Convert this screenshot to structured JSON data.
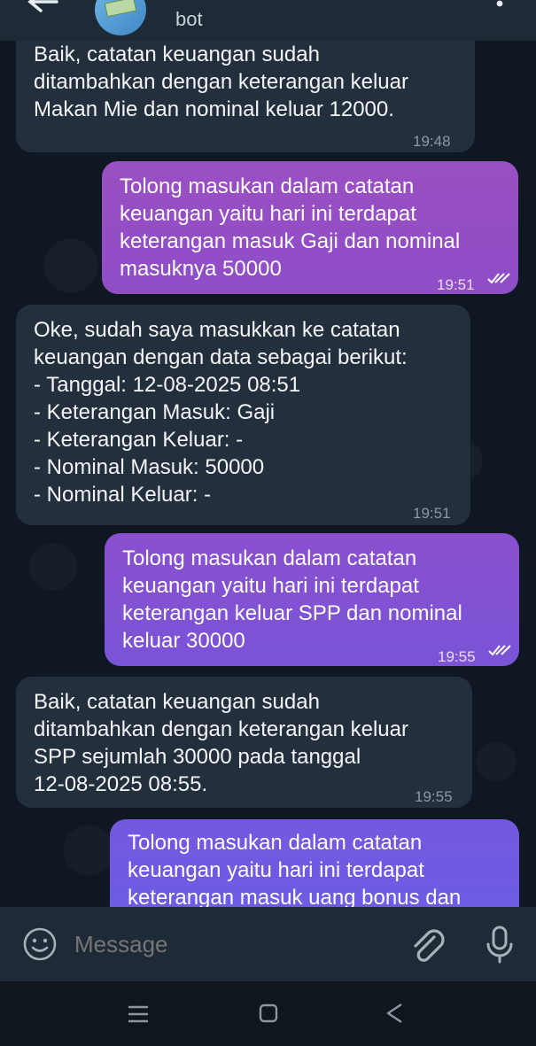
{
  "header": {
    "title": "bot"
  },
  "messages": [
    {
      "direction": "incoming",
      "text": "Baik, catatan keuangan sudah\nditambahkan dengan keterangan keluar\nMakan Mie dan nominal keluar 12000.",
      "time": "19:48"
    },
    {
      "direction": "outgoing",
      "text": "Tolong masukan dalam catatan\nkeuangan yaitu hari ini terdapat\nketerangan masuk Gaji dan nominal\nmasuknya 50000",
      "time": "19:51",
      "status": "read"
    },
    {
      "direction": "incoming",
      "text": "Oke, sudah saya masukkan ke catatan\nkeuangan dengan data sebagai berikut:\n- Tanggal: 12-08-2025 08:51\n- Keterangan Masuk: Gaji\n- Keterangan Keluar: -\n- Nominal Masuk: 50000\n- Nominal Keluar: -",
      "time": "19:51"
    },
    {
      "direction": "outgoing",
      "text": "Tolong masukan dalam catatan\nkeuangan yaitu hari ini terdapat\nketerangan keluar SPP dan nominal\nkeluar 30000",
      "time": "19:55",
      "status": "read"
    },
    {
      "direction": "incoming",
      "text": "Baik, catatan keuangan sudah\nditambahkan dengan keterangan keluar\nSPP sejumlah 30000 pada tanggal\n12-08-2025 08:55.",
      "time": "19:55"
    },
    {
      "direction": "outgoing",
      "text": "Tolong masukan dalam catatan\nkeuangan yaitu hari ini terdapat\nketerangan masuk uang bonus dan",
      "time": "",
      "status": ""
    }
  ],
  "input": {
    "placeholder": "Message"
  },
  "icons": {
    "back": "arrow-left-icon",
    "menu": "more-vertical-icon",
    "emoji": "smile-icon",
    "attach": "paperclip-icon",
    "mic": "microphone-icon"
  },
  "colors": {
    "incoming_bubble": "#232f3c",
    "outgoing_gradient_top": "#9b4fc4",
    "outgoing_gradient_bottom": "#6a5de8",
    "chat_background": "#0f1722"
  }
}
